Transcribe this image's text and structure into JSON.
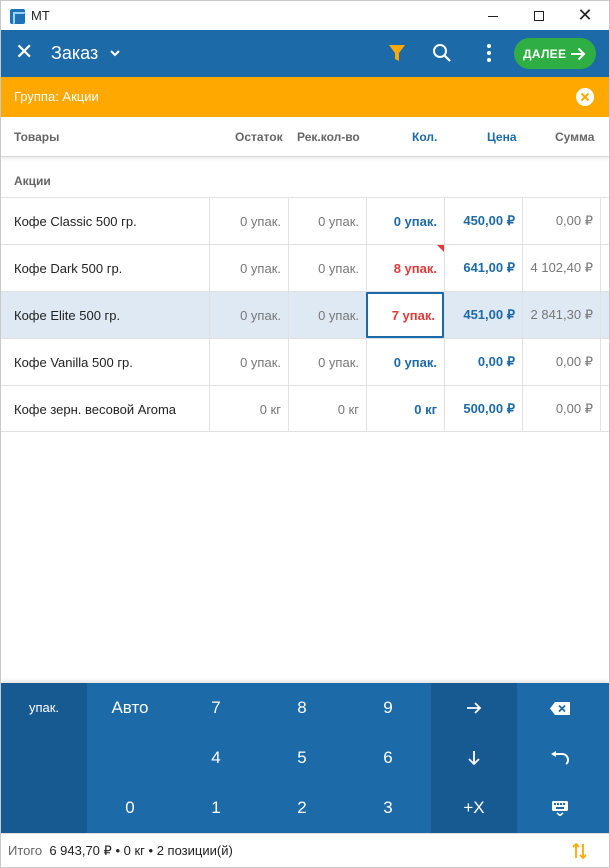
{
  "window": {
    "title": "MT",
    "minimize_glyph": "—",
    "maximize_glyph": "☐",
    "close_glyph": "✕"
  },
  "appbar": {
    "close_glyph": "✕",
    "title": "Заказ",
    "next_label": "ДАЛЕЕ",
    "filter_color": "#ffa800",
    "accent": "#1d6aa8",
    "next_color": "#2fae43"
  },
  "banner": {
    "text": "Группа: Акции",
    "color": "#ffa800"
  },
  "columns": {
    "name": "Товары",
    "stock": "Остаток",
    "recommended": "Рек.кол-во",
    "quantity": "Кол.",
    "price": "Цена",
    "sum": "Сумма"
  },
  "group": "Акции",
  "rows": [
    {
      "name": "Кофе Classic 500 гр.",
      "stock": "0 упак.",
      "recommended": "0 упак.",
      "quantity": "0 упак.",
      "price": "450,00 ₽",
      "sum": "0,00 ₽"
    },
    {
      "name": "Кофе Dark 500 гр.",
      "stock": "0 упак.",
      "recommended": "0 упак.",
      "quantity": "8 упак.",
      "price": "641,00 ₽",
      "sum": "4 102,40 ₽"
    },
    {
      "name": "Кофе Elite 500 гр.",
      "stock": "0 упак.",
      "recommended": "0 упак.",
      "quantity": "7 упак.",
      "price": "451,00 ₽",
      "sum": "2 841,30 ₽"
    },
    {
      "name": "Кофе Vanilla 500 гр.",
      "stock": "0 упак.",
      "recommended": "0 упак.",
      "quantity": "0 упак.",
      "price": "0,00 ₽",
      "sum": "0,00 ₽"
    },
    {
      "name": "Кофе зерн. весовой Aroma",
      "stock": "0 кг",
      "recommended": "0 кг",
      "quantity": "0 кг",
      "price": "500,00 ₽",
      "sum": "0,00 ₽"
    }
  ],
  "keypad": {
    "unit": "упак.",
    "auto": "Авто",
    "k7": "7",
    "k8": "8",
    "k9": "9",
    "k4": "4",
    "k5": "5",
    "k6": "6",
    "k0": "0",
    "k1": "1",
    "k2": "2",
    "k3": "3",
    "plus_x": "+X",
    "icons": [
      "arrow-right-icon",
      "backspace-icon",
      "arrow-down-icon",
      "undo-icon",
      "keyboard-icon"
    ]
  },
  "footer": {
    "label": "Итого",
    "total": "6 943,70 ₽",
    "weight": "0 кг",
    "positions": "2 позиции(й)",
    "separator": "•"
  }
}
